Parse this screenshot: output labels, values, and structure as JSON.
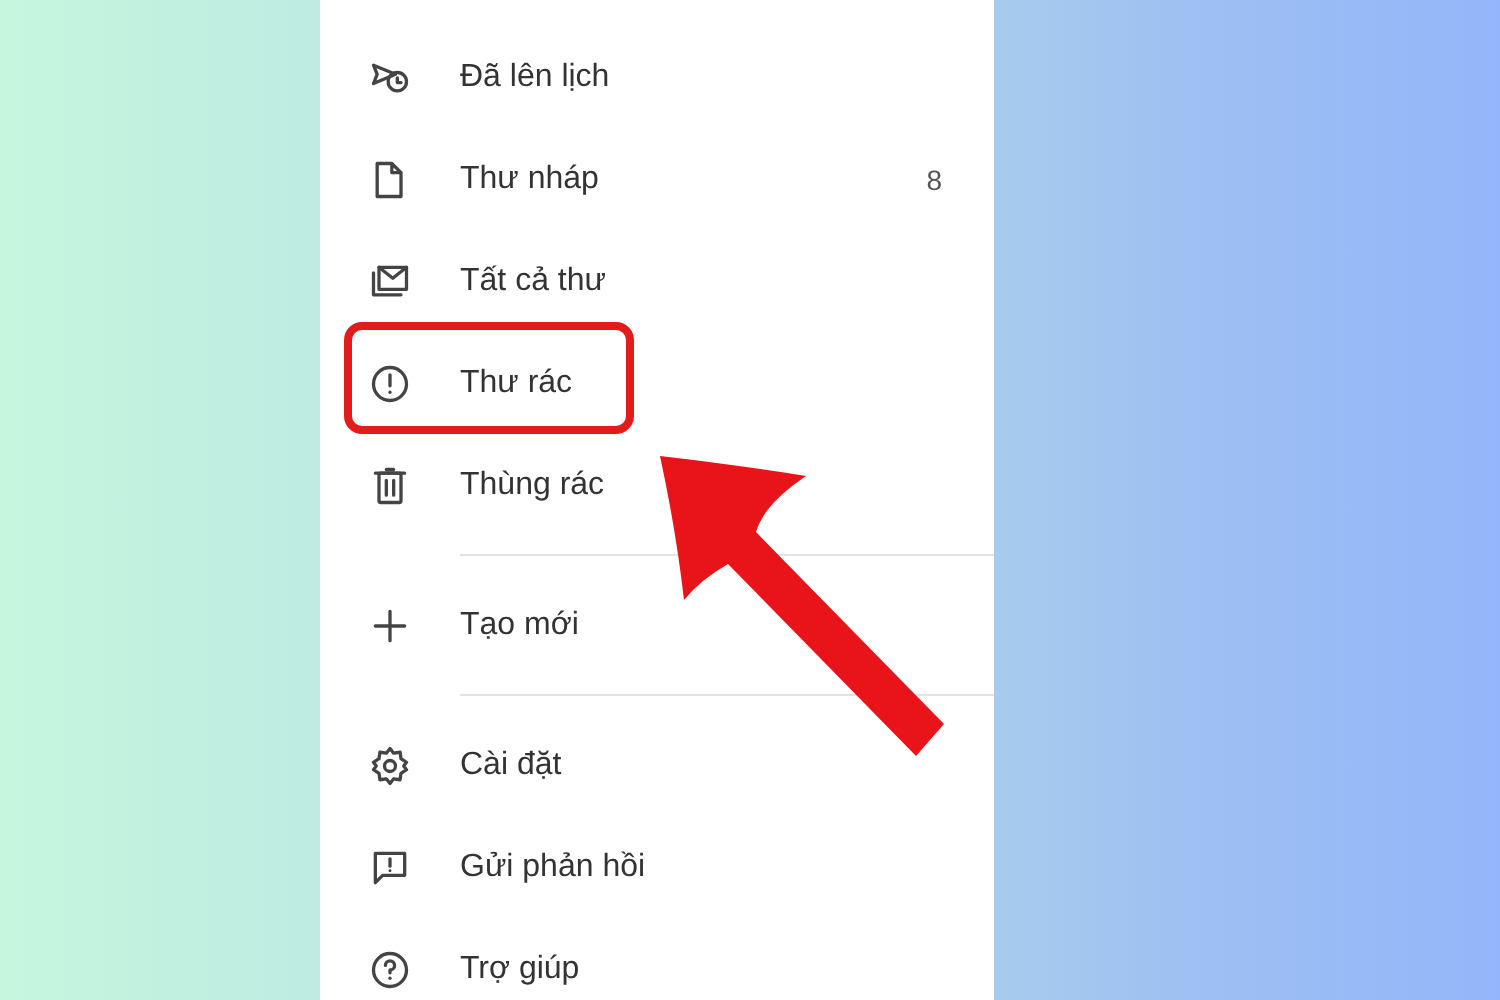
{
  "menu": {
    "sections": [
      {
        "items": [
          {
            "label": "Đã lên lịch",
            "highlighted": false
          },
          {
            "label": "Thư nháp",
            "count": "8",
            "highlighted": false
          },
          {
            "label": "Tất cả thư",
            "highlighted": false
          },
          {
            "label": "Thư rác",
            "highlighted": true
          },
          {
            "label": "Thùng rác",
            "highlighted": false
          }
        ]
      },
      {
        "items": [
          {
            "label": "Tạo mới",
            "highlighted": false
          }
        ]
      },
      {
        "items": [
          {
            "label": "Cài đặt",
            "highlighted": false
          },
          {
            "label": "Gửi phản hồi",
            "highlighted": false
          },
          {
            "label": "Trợ giúp",
            "highlighted": false
          }
        ]
      }
    ]
  }
}
